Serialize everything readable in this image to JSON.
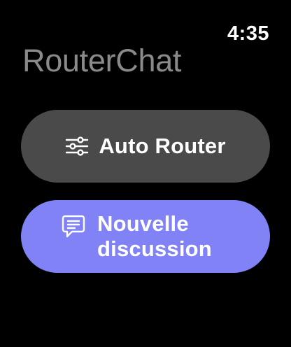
{
  "status": {
    "time": "4:35"
  },
  "app": {
    "title": "RouterChat"
  },
  "buttons": {
    "auto_router": {
      "label": "Auto Router",
      "icon": "sliders-icon",
      "background": "#4a4a4a"
    },
    "new_chat": {
      "label": "Nouvelle discussion",
      "icon": "chat-bubble-icon",
      "background": "#8082f5"
    }
  },
  "colors": {
    "background": "#000000",
    "title_text": "#8a8a8a",
    "button_text": "#ffffff"
  }
}
